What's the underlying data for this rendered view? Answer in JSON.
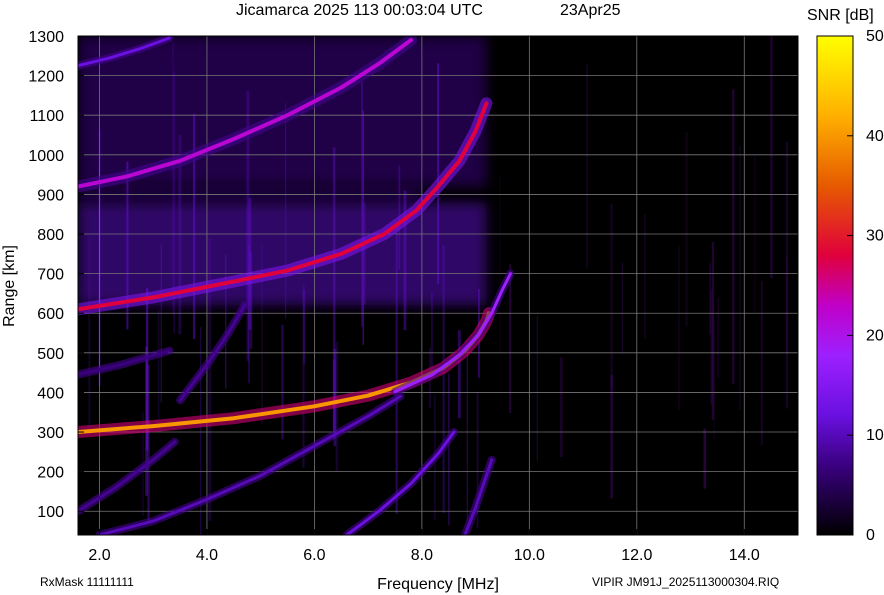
{
  "header": {
    "title": "Jicamarca 2025 113 00:03:04 UTC",
    "date": "23Apr25"
  },
  "footer": {
    "rxmask": "RxMask 11111111",
    "file": "VIPIR  JM91J_2025113000304.RIQ"
  },
  "chart_data": {
    "type": "heatmap",
    "xlabel": "Frequency [MHz]",
    "ylabel": "Range [km]",
    "xlim": [
      1.6,
      15.0
    ],
    "ylim": [
      40,
      1300
    ],
    "x_ticks": [
      2.0,
      4.0,
      6.0,
      8.0,
      10.0,
      12.0,
      14.0
    ],
    "x_tick_labels": [
      "2.0",
      "4.0",
      "6.0",
      "8.0",
      "10.0",
      "12.0",
      "14.0"
    ],
    "y_ticks": [
      100,
      200,
      300,
      400,
      500,
      600,
      700,
      800,
      900,
      1000,
      1100,
      1200,
      1300
    ],
    "y_tick_labels": [
      "100",
      "200",
      "300",
      "400",
      "500",
      "600",
      "700",
      "800",
      "900",
      "1000",
      "1100",
      "1200",
      "1300"
    ],
    "grid": true,
    "colorbar": {
      "label": "SNR [dB]",
      "range": [
        0,
        50
      ],
      "ticks": [
        0,
        10,
        20,
        30,
        40,
        50
      ],
      "tick_labels": [
        "0",
        "10",
        "20",
        "30",
        "40",
        "50"
      ],
      "colors": [
        "#000000",
        "#5a00b4",
        "#8a1fff",
        "#b400c8",
        "#e0003c",
        "#e65a00",
        "#ffc800",
        "#ffff00"
      ]
    },
    "traces": [
      {
        "points": [
          [
            1.6,
            300
          ],
          [
            3.0,
            315
          ],
          [
            4.5,
            335
          ],
          [
            6.0,
            365
          ],
          [
            7.0,
            392
          ],
          [
            7.8,
            425
          ],
          [
            8.4,
            462
          ],
          [
            8.8,
            505
          ],
          [
            9.05,
            545
          ],
          [
            9.2,
            580
          ],
          [
            9.25,
            600
          ]
        ],
        "snr": 40
      },
      {
        "points": [
          [
            7.5,
            402
          ],
          [
            8.2,
            445
          ],
          [
            8.7,
            495
          ],
          [
            9.05,
            545
          ],
          [
            9.3,
            600
          ],
          [
            9.5,
            660
          ],
          [
            9.65,
            700
          ]
        ],
        "snr": 18
      },
      {
        "points": [
          [
            1.6,
            610
          ],
          [
            3.0,
            640
          ],
          [
            4.5,
            680
          ],
          [
            5.5,
            708
          ],
          [
            6.5,
            750
          ],
          [
            7.3,
            800
          ],
          [
            7.9,
            860
          ],
          [
            8.3,
            920
          ],
          [
            8.7,
            985
          ],
          [
            9.0,
            1060
          ],
          [
            9.2,
            1130
          ]
        ],
        "snr": 28
      },
      {
        "points": [
          [
            1.6,
            920
          ],
          [
            2.5,
            945
          ],
          [
            3.5,
            985
          ],
          [
            4.5,
            1040
          ],
          [
            5.5,
            1100
          ],
          [
            6.5,
            1170
          ],
          [
            7.2,
            1230
          ],
          [
            7.8,
            1290
          ]
        ],
        "snr": 22
      },
      {
        "points": [
          [
            1.6,
            1225
          ],
          [
            2.2,
            1245
          ],
          [
            2.8,
            1270
          ],
          [
            3.3,
            1295
          ]
        ],
        "snr": 12
      },
      {
        "points": [
          [
            2.0,
            40
          ],
          [
            3.0,
            75
          ],
          [
            4.0,
            130
          ],
          [
            5.0,
            190
          ],
          [
            6.0,
            265
          ],
          [
            7.0,
            340
          ],
          [
            7.6,
            390
          ]
        ],
        "snr": 10
      },
      {
        "points": [
          [
            6.6,
            40
          ],
          [
            7.2,
            100
          ],
          [
            7.8,
            170
          ],
          [
            8.3,
            245
          ],
          [
            8.6,
            300
          ]
        ],
        "snr": 12
      },
      {
        "points": [
          [
            8.8,
            40
          ],
          [
            9.0,
            110
          ],
          [
            9.2,
            190
          ],
          [
            9.3,
            230
          ]
        ],
        "snr": 10
      },
      {
        "points": [
          [
            3.5,
            380
          ],
          [
            4.0,
            470
          ],
          [
            4.4,
            550
          ],
          [
            4.7,
            620
          ]
        ],
        "snr": 8
      },
      {
        "points": [
          [
            1.6,
            100
          ],
          [
            2.3,
            160
          ],
          [
            3.0,
            230
          ],
          [
            3.4,
            275
          ]
        ],
        "snr": 8
      },
      {
        "points": [
          [
            1.6,
            445
          ],
          [
            2.4,
            470
          ],
          [
            3.3,
            505
          ]
        ],
        "snr": 7
      }
    ],
    "diffuse_regions": [
      {
        "x": [
          1.6,
          9.2
        ],
        "y": [
          620,
          880
        ],
        "snr": 10
      },
      {
        "x": [
          1.6,
          9.2
        ],
        "y": [
          920,
          1300
        ],
        "snr": 7
      },
      {
        "x": [
          1.6,
          8.0
        ],
        "y": [
          880,
          920
        ],
        "snr": 6
      }
    ]
  }
}
